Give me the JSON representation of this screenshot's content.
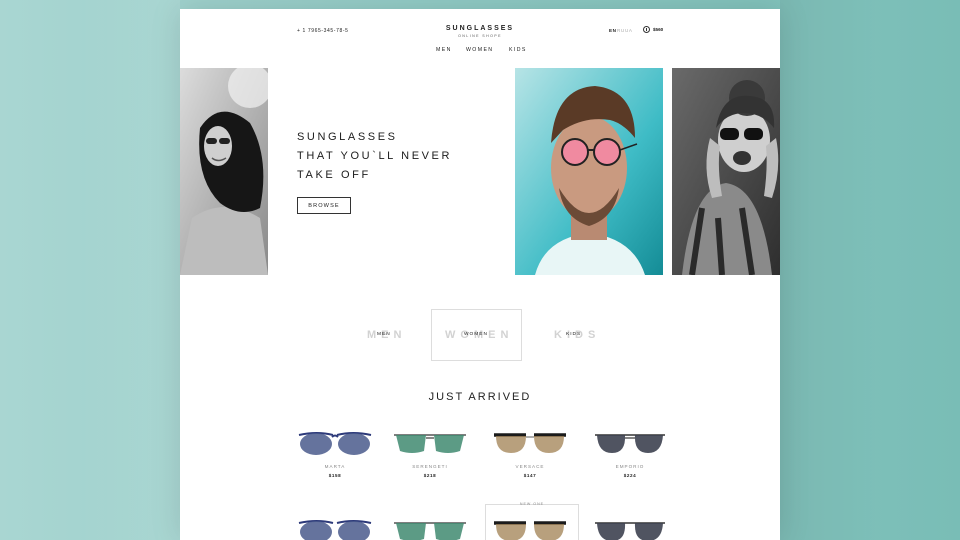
{
  "header": {
    "phone": "+ 1 7965-345-78-5",
    "logo": {
      "title": "SUNGLASSES",
      "subtitle": "ONLINE SHOPE"
    },
    "languages": [
      {
        "label": "EN",
        "active": true
      },
      {
        "label": "RU",
        "active": false
      },
      {
        "label": "UA",
        "active": false
      }
    ],
    "cart_total": "$560"
  },
  "nav": [
    "MEN",
    "WOMEN",
    "KIDS"
  ],
  "hero": {
    "title_lines": [
      "SUNGLASSES",
      "THAT YOU`LL NEVER",
      "TAKE OFF"
    ],
    "browse_label": "BROWSE"
  },
  "categories": {
    "ghost": [
      "MEN",
      "WOMEN",
      "KIDS"
    ],
    "labels": [
      "MEN",
      "WOMEN",
      "KIDS"
    ],
    "selected": "WOMEN"
  },
  "just_arrived": {
    "title": "JUST ARRIVED",
    "products": [
      {
        "name": "MARTA",
        "price": "$158",
        "lens": "#4a5a8c",
        "frame": "#2d3a7a"
      },
      {
        "name": "SERENGETI",
        "price": "$218",
        "lens": "#3f8a70",
        "frame": "#555555"
      },
      {
        "name": "VERSACE",
        "price": "$147",
        "lens": "#a08052",
        "frame": "#1b1b1b"
      },
      {
        "name": "EMPORIO",
        "price": "$224",
        "lens": "#3d4150",
        "frame": "#333333"
      }
    ],
    "featured_label": "NEW ONE"
  },
  "colors": {
    "page_bg": "#ffffff",
    "backdrop": "#8fcac4",
    "accent_teal": "#38c6c6"
  }
}
